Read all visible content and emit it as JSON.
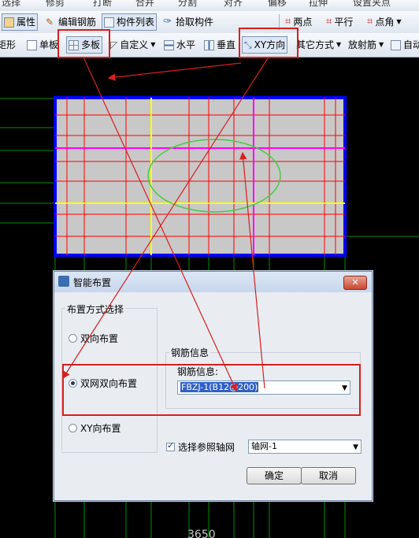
{
  "toolbar_top": {
    "items": [
      "选择",
      "修剪",
      "打断",
      "合并",
      "分割",
      "对齐",
      "偏移",
      "拉伸",
      "设置夹点"
    ]
  },
  "toolbar1": {
    "properties": "属性",
    "edit_rebar": "编辑钢筋",
    "component_list": "构件列表",
    "pick_component": "拾取构件",
    "two_points": "两点",
    "parallel": "平行",
    "point_angle": "点角"
  },
  "toolbar2": {
    "rect_partial": "矩形",
    "single_slab": "单板",
    "multi_slab": "多板",
    "custom": "自定义",
    "horizontal": "水平",
    "vertical": "垂直",
    "xy_direction": "XY方向",
    "other_methods": "其它方式",
    "radial_rebar": "放射筋",
    "auto_partial": "自动"
  },
  "dialog": {
    "title": "智能布置",
    "close": "✕",
    "layout_group": "布置方式选择",
    "radio_two_way": "双向布置",
    "radio_double_net": "双网双向布置",
    "radio_xy": "XY向布置",
    "rebar_group": "钢筋信息",
    "rebar_label": "钢筋信息:",
    "rebar_value": "FBZJ-1(B12@200)",
    "axis_checkbox": "选择参照轴网",
    "axis_value": "轴网-1",
    "ok": "确定",
    "cancel": "取消"
  },
  "canvas": {
    "dimension": "3650"
  },
  "colors": {
    "slab_border": "#0000ff",
    "rebar_red": "#ff0000",
    "rebar_magenta": "#ff00ff",
    "rebar_yellow": "#ffff00",
    "opening": "#33cc33",
    "annotation": "#d81e1e",
    "grid_green": "#00a000"
  }
}
